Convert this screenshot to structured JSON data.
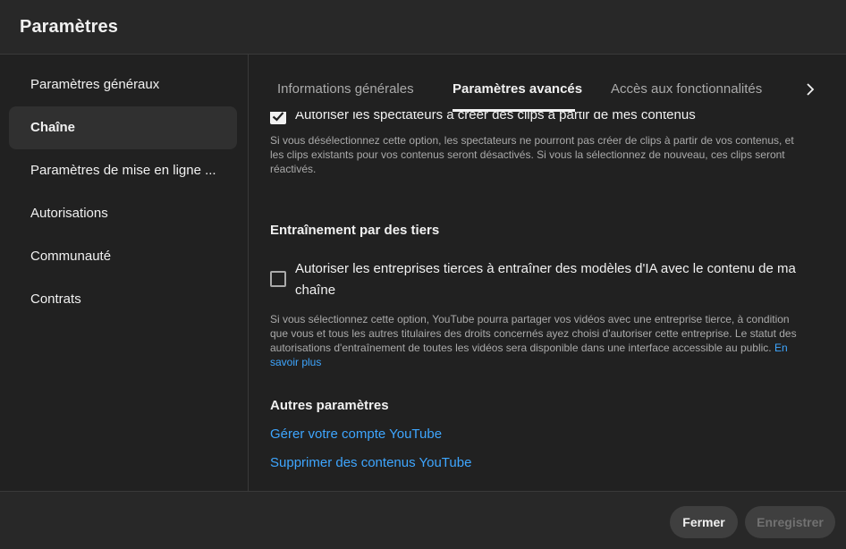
{
  "dialog": {
    "title": "Paramètres"
  },
  "sidebar": {
    "items": [
      {
        "label": "Paramètres généraux"
      },
      {
        "label": "Chaîne",
        "active": true
      },
      {
        "label": "Paramètres de mise en ligne ..."
      },
      {
        "label": "Autorisations"
      },
      {
        "label": "Communauté"
      },
      {
        "label": "Contrats"
      }
    ]
  },
  "tabs": {
    "items": [
      {
        "label": "Informations générales"
      },
      {
        "label": "Paramètres avancés",
        "active": true
      },
      {
        "label": "Accès aux fonctionnalités"
      }
    ],
    "next_icon": "chevron-right-icon"
  },
  "clips": {
    "label": "Autoriser les spectateurs à créer des clips à partir de mes contenus",
    "checked": true,
    "description": "Si vous désélectionnez cette option, les spectateurs ne pourront pas créer de clips à partir de vos contenus, et les clips existants pour vos contenus seront désactivés. Si vous la sélectionnez de nouveau, ces clips seront réactivés."
  },
  "third_party": {
    "title": "Entraînement par des tiers",
    "label": "Autoriser les entreprises tierces à entraîner des modèles d'IA avec le contenu de ma chaîne",
    "checked": false,
    "description": "Si vous sélectionnez cette option, YouTube pourra partager vos vidéos avec une entreprise tierce, à condition que vous et tous les autres titulaires des droits concernés ayez choisi d'autoriser cette entreprise. Le statut des autorisations d'entraînement de toutes les vidéos sera disponible dans une interface accessible au public.",
    "learn_more": "En savoir plus"
  },
  "other": {
    "title": "Autres paramètres",
    "links": [
      {
        "label": "Gérer votre compte YouTube"
      },
      {
        "label": "Supprimer des contenus YouTube"
      }
    ]
  },
  "footer": {
    "close_label": "Fermer",
    "save_label": "Enregistrer"
  },
  "colors": {
    "accent_link": "#3ea6ff",
    "background": "#282828",
    "panel": "#212121"
  }
}
